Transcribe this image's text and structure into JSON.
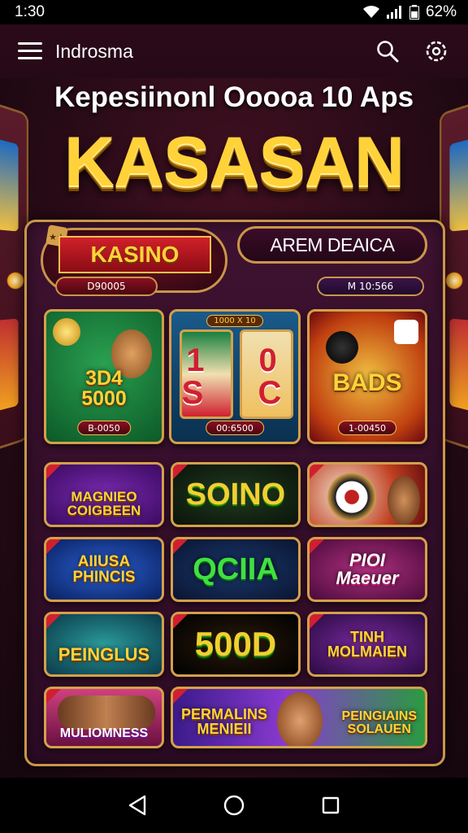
{
  "status_bar": {
    "time": "1:30",
    "battery": "62%"
  },
  "app_bar": {
    "title": "Indrosma",
    "search_icon": "search-icon",
    "settings_icon": "settings-icon"
  },
  "headline": "Kepesiinonl Ooooa 10 Aps",
  "brand": "KASASAN",
  "tabs": {
    "kasino": {
      "label": "KASINO",
      "sub": "D90005"
    },
    "arem": {
      "label": "AREM DEAICA",
      "sub": "M 10:566"
    }
  },
  "featured": [
    {
      "label": "3D4\n5000",
      "sub": "B-0050",
      "theme": "green"
    },
    {
      "label": "1 0\nS C",
      "badge": "1000 X 10",
      "sub": "00:6500",
      "theme": "slot"
    },
    {
      "label": "BADS",
      "sub": "1-00450",
      "theme": "gold"
    }
  ],
  "games": [
    {
      "label": "MAGNIEO\nCOIGBEEN",
      "theme": "purple"
    },
    {
      "label": "SOINO",
      "theme": "dark"
    },
    {
      "label": "",
      "theme": "roulette"
    },
    {
      "label": "AIIUSA\nPHINCIS",
      "theme": "blue"
    },
    {
      "label": "QCIIA",
      "theme": "navy"
    },
    {
      "label": "PIOI\nMaeuer",
      "theme": "violet"
    },
    {
      "label": "PEINGLUS",
      "theme": "teal"
    },
    {
      "label": "500D",
      "theme": "black"
    },
    {
      "label": "TINH\nMOLMAIEN",
      "theme": "plum"
    },
    {
      "label": "MULIOMNESS",
      "theme": "pink"
    },
    {
      "label": "PERMALINS\nMENIEII",
      "theme": "wide"
    },
    {
      "label": "PEINGIAINS\nSOLAUEN",
      "theme": "green2"
    }
  ],
  "colors": {
    "gold": "#ffd23a",
    "frame": "#c9964a",
    "background": "#2a0b18"
  },
  "nav": {
    "back_icon": "back-icon",
    "home_icon": "home-icon",
    "recents_icon": "recents-icon"
  }
}
